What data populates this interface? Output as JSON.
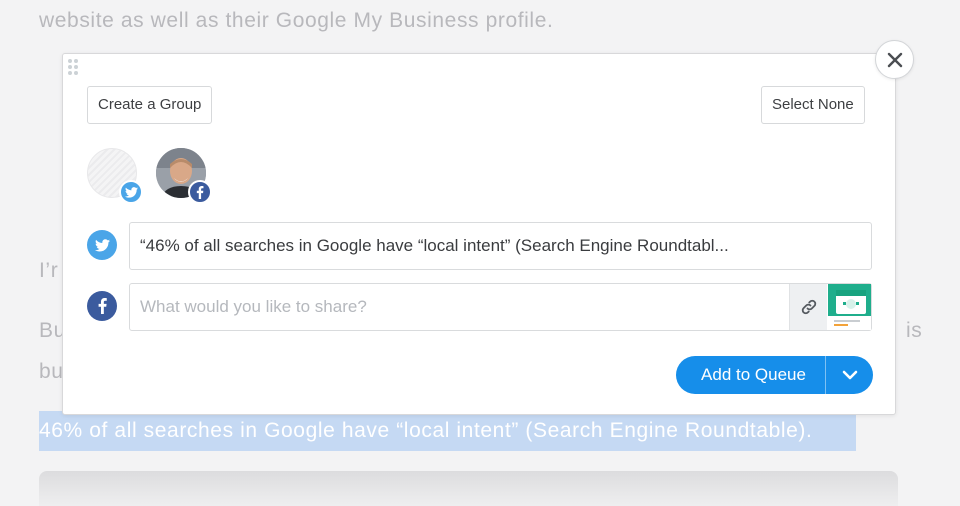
{
  "article": {
    "line_top": "website as well as their Google My Business profile.",
    "fragment_im": "I’r",
    "fragment_bu": "Bu",
    "fragment_is": "is",
    "fragment_bu2": "bu",
    "highlighted_quote": "46% of all searches in Google have “local intent” (Search Engine Roundtable)."
  },
  "composer": {
    "create_group_label": "Create a Group",
    "select_none_label": "Select None",
    "profiles": [
      {
        "network": "twitter",
        "badge_icon": "twitter-icon"
      },
      {
        "network": "facebook",
        "badge_icon": "facebook-icon"
      }
    ],
    "twitter_text": "“46% of all searches in Google have “local intent” (Search Engine Roundtabl...",
    "facebook_placeholder": "What would you like to share?",
    "facebook_value": "",
    "add_to_queue_label": "Add to Queue"
  },
  "colors": {
    "twitter": "#4aa5e8",
    "facebook": "#3b5b9e",
    "primary": "#168eea",
    "highlight": "#c5d9f3"
  }
}
